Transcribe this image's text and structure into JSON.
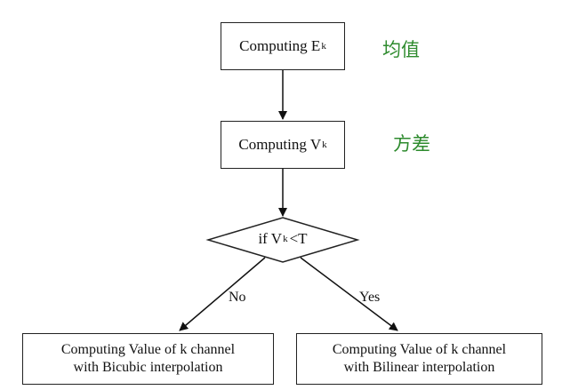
{
  "nodes": {
    "ek": {
      "text": "Computing E",
      "sub": "k"
    },
    "vk": {
      "text": "Computing V",
      "sub": "k"
    },
    "decision": {
      "prefix": "if V",
      "sub": "k",
      "suffix": "<T"
    },
    "left": {
      "line1": "Computing Value of k channel",
      "line2": "with Bicubic interpolation"
    },
    "right": {
      "line1": "Computing Value of k channel",
      "line2": "with Bilinear interpolation"
    }
  },
  "branches": {
    "no": "No",
    "yes": "Yes"
  },
  "notes": {
    "mean": "均值",
    "variance": "方差"
  },
  "colors": {
    "annotation": "#2e8b2e",
    "stroke": "#222222"
  }
}
